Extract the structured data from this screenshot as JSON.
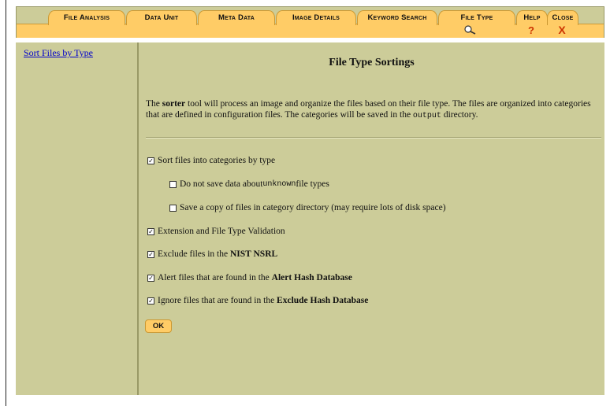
{
  "nav": {
    "tabs": [
      {
        "label": "File Analysis"
      },
      {
        "label": "Data Unit"
      },
      {
        "label": "Meta Data"
      },
      {
        "label": "Image Details"
      },
      {
        "label": "Keyword Search"
      },
      {
        "label": "File Type"
      },
      {
        "label": "Help"
      },
      {
        "label": "Close"
      }
    ],
    "help_glyph": "?",
    "close_glyph": "X"
  },
  "sidebar": {
    "link": "Sort Files by Type"
  },
  "main": {
    "title": "File Type Sortings",
    "desc_pre": "The ",
    "desc_bold": "sorter",
    "desc_mid": " tool will process an image and organize the files based on their file type. The files are organized into categories that are defined in configuration files. The categories will be saved in the ",
    "desc_code": "output",
    "desc_post": " directory.",
    "options": [
      {
        "pre": "Sort files into categories by type",
        "checked": true
      },
      {
        "pre": "Do not save data about ",
        "code": "unknown",
        "post": " file types",
        "checked": false
      },
      {
        "pre": "Save a copy of files in category directory (may require lots of disk space)",
        "checked": false
      },
      {
        "pre": "Extension and File Type Validation",
        "checked": true
      },
      {
        "pre": "Exclude files in the ",
        "bold": "NIST NSRL",
        "checked": true
      },
      {
        "pre": "Alert files that are found in the ",
        "bold": "Alert Hash Database",
        "checked": true
      },
      {
        "pre": "Ignore files that are found in the ",
        "bold": "Exclude Hash Database",
        "checked": true
      }
    ],
    "ok_label": "OK"
  },
  "colors": {
    "panel": "#cccc99",
    "tab": "#ffcc66",
    "link": "#0000cc",
    "accent": "#cc3300"
  }
}
